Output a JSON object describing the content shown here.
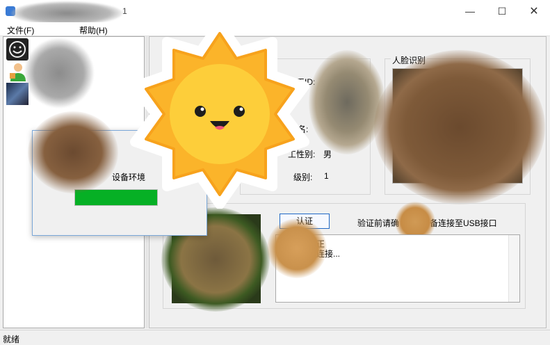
{
  "window": {
    "title": "1",
    "controls": {
      "minimize": "—",
      "maximize": "☐",
      "close": "✕"
    }
  },
  "menu": {
    "file": "文件(F)",
    "help": "帮助(H)"
  },
  "user_list": [
    {
      "icon": "smiley-avatar-icon"
    },
    {
      "icon": "person-avatar-icon"
    },
    {
      "icon": "photo-thumbnail-icon"
    }
  ],
  "employee": {
    "id_label": "员工ID:",
    "name_label": "名:",
    "gender_label": "工性别:",
    "gender_value": "男",
    "level_label": "级别:",
    "level_value": "1"
  },
  "face_group": {
    "title": "人脸识别"
  },
  "auth": {
    "button_label": "认证",
    "hint": "验证前请确",
    "hint_tail": "备连接至USB接口"
  },
  "log": {
    "line1": "正",
    "line2": "连接..."
  },
  "progress_dialog": {
    "message": "设备环境",
    "progress": 1.0,
    "fill_color": "#06b025"
  },
  "status": {
    "text": "就绪"
  },
  "colors": {
    "accent": "#1f68c5",
    "progress": "#06b025",
    "sun": "#fbb42a"
  }
}
